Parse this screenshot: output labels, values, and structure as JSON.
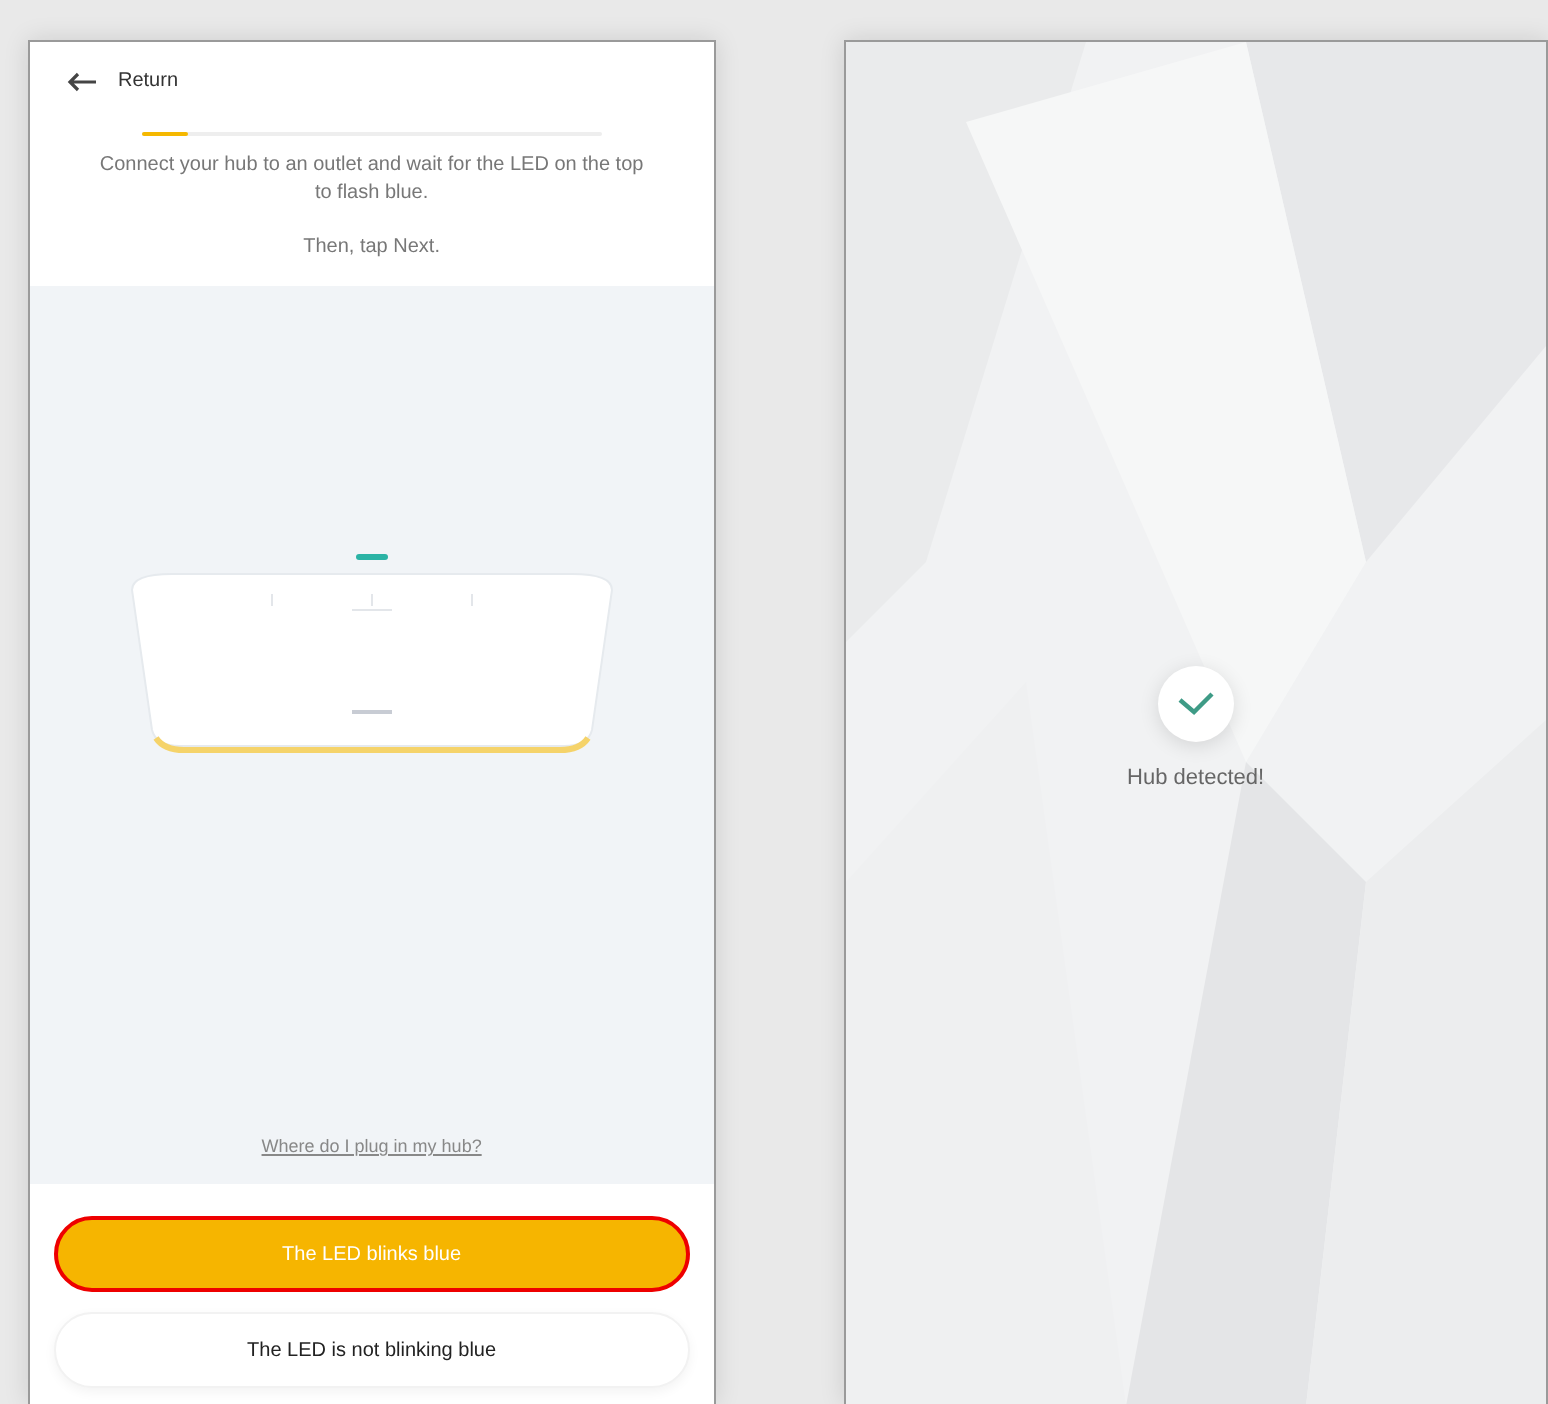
{
  "setup_screen": {
    "back_label": "Return",
    "progress": {
      "level": 0.1
    },
    "instruction": "Connect your hub to an outlet and wait for the LED on the top to flash blue.",
    "hint": "Then, tap Next.",
    "help_link": "Where do I plug in my hub?",
    "buttons": [
      {
        "label": "The LED blinks blue",
        "kind": "primary"
      },
      {
        "label": "The LED is not blinking blue",
        "kind": "secondary"
      }
    ]
  },
  "detected_screen": {
    "status": "Hub detected!"
  }
}
